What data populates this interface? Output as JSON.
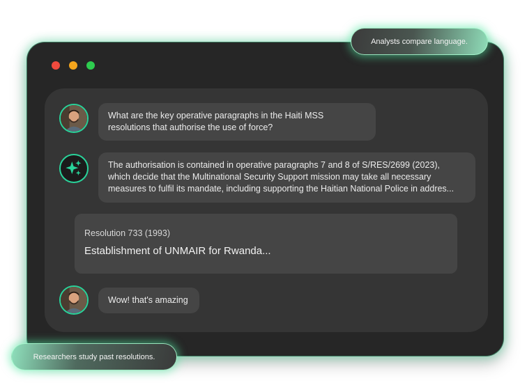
{
  "window": {
    "traffic_lights": [
      "close",
      "minimize",
      "zoom"
    ]
  },
  "chat": {
    "user_question": {
      "line1": "What are the key operative paragraphs in the Haiti MSS",
      "line2": "resolutions that authorise the use of force?"
    },
    "assistant_answer": {
      "line1": "The authorisation is contained in operative paragraphs 7 and 8 of S/RES/2699 (2023),",
      "line2": "which decide that the Multinational Security Support mission may take all necessary",
      "line3": "measures to fulfil its mandate, including supporting the Haitian National Police in addres..."
    },
    "resolution_card": {
      "subtitle": "Resolution 733 (1993)",
      "title": "Establishment of UNMAIR for Rwanda..."
    },
    "user_reply": "Wow! that's amazing"
  },
  "badges": {
    "top": "Analysts compare language.",
    "bottom": "Researchers study past resolutions."
  },
  "colors": {
    "window_bg": "#262626",
    "panel_bg": "#353535",
    "bubble_bg": "#454545",
    "accent": "#29d39a"
  }
}
